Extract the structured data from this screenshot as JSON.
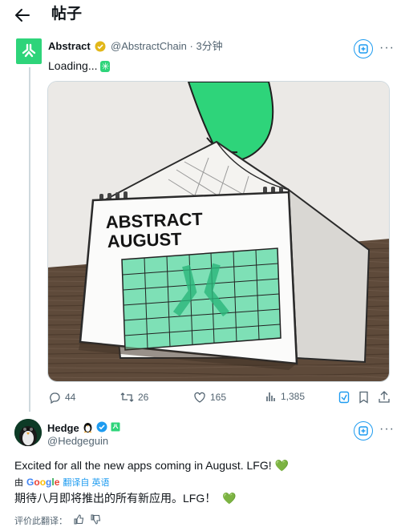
{
  "header": {
    "title": "帖子"
  },
  "post": {
    "author_name": "Abstract",
    "author_handle": "@AbstractChain",
    "separator": "·",
    "time": "3分钟",
    "text": "Loading... ",
    "text_emoji": "✳",
    "image_text_line1": "ABSTRACT",
    "image_text_line2": "AUGUST",
    "stats": {
      "replies": "44",
      "reposts": "26",
      "likes": "165",
      "views": "1,385"
    }
  },
  "reply": {
    "author_name": "Hedge",
    "author_handle": "@Hedgeguin",
    "text": "Excited for all the new apps coming in August. LFG! ",
    "heart": "💚",
    "translate_prefix": "由",
    "google_label": "Google",
    "translate_label": "翻译自 英语",
    "translated_text": "期待八月即将推出的所有新应用。LFG！",
    "rate_label": "评价此翻译："
  },
  "colors": {
    "accent": "#1d9bf0",
    "brand_green": "#2ed47a",
    "verified_gold": "#e2b719",
    "muted": "#536471"
  }
}
